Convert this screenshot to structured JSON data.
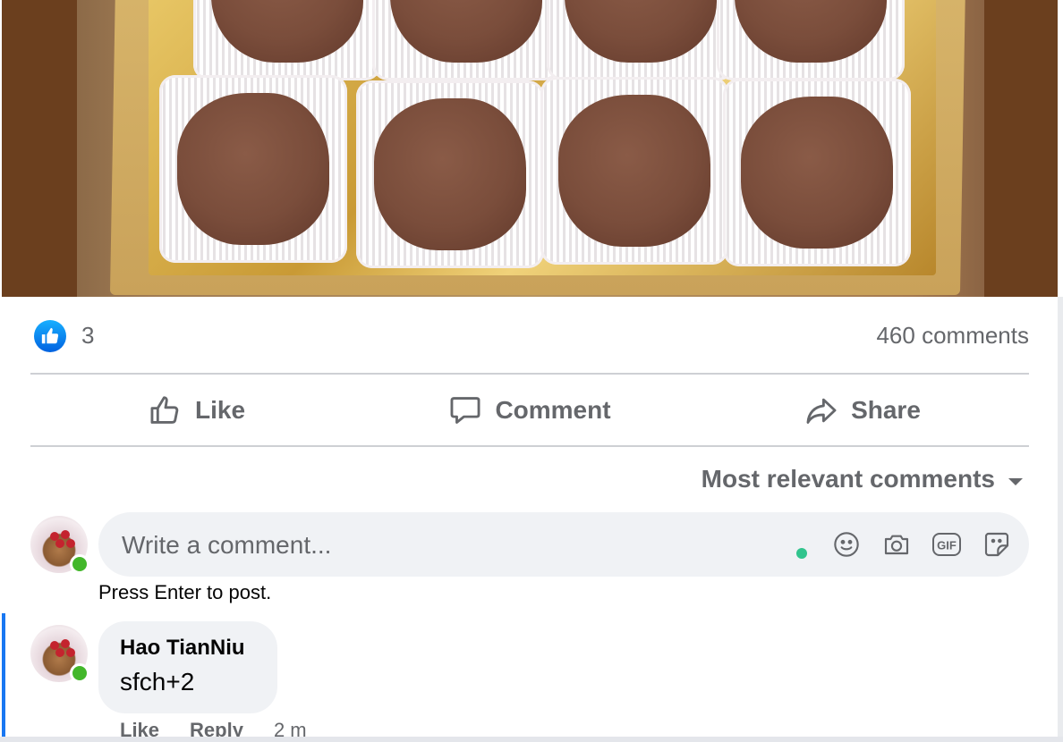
{
  "post": {
    "photo_icon": "chocolate-truffles-photo",
    "reactions": {
      "icon": "like-reaction-icon",
      "count": "3"
    },
    "comments_count": "460 comments"
  },
  "actions": {
    "like_label": "Like",
    "comment_label": "Comment",
    "share_label": "Share"
  },
  "sort": {
    "label": "Most relevant comments",
    "icon": "caret-down-icon"
  },
  "composer": {
    "placeholder": "Write a comment...",
    "hint": "Press Enter to post.",
    "tools": [
      "emoji-icon",
      "camera-icon",
      "gif-icon",
      "sticker-icon"
    ]
  },
  "comments": [
    {
      "author": "Hao TianNiu",
      "text": "sfch+2",
      "like_label": "Like",
      "reply_label": "Reply",
      "time": "2 m"
    }
  ],
  "colors": {
    "accent": "#1877f2",
    "secondary_text": "#65676b",
    "bubble_bg": "#f0f2f5",
    "online": "#42b72a"
  }
}
